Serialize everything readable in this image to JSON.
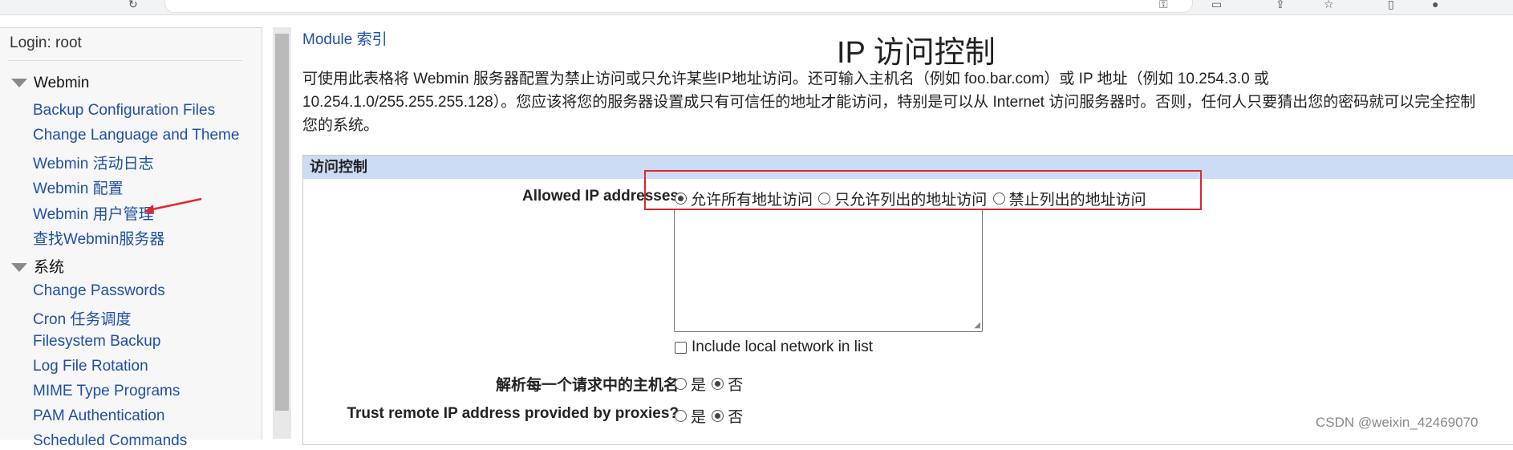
{
  "nav": {
    "login": "Login: root",
    "categories": [
      {
        "label": "Webmin",
        "items": [
          "Backup Configuration Files",
          "Change Language and Theme",
          "Webmin 活动日志",
          "Webmin 配置",
          "Webmin 用户管理",
          "查找Webmin服务器"
        ]
      },
      {
        "label": "系统",
        "items": [
          "Change Passwords",
          "Cron 任务调度",
          "Filesystem Backup",
          "Log File Rotation",
          "MIME Type Programs",
          "PAM Authentication",
          "Scheduled Commands"
        ]
      }
    ]
  },
  "main": {
    "module_index": "Module 索引",
    "title": "IP 访问控制",
    "description": [
      "可使用此表格将 Webmin 服务器配置为禁止访问或只允许某些IP地址访问。还可输入主机名（例如 foo.bar.com）或 IP 地址（例如 10.254.3.0 或",
      "10.254.1.0/255.255.255.128）。您应该将您的服务器设置成只有可信任的地址才能访问，特别是可以从 Internet 访问服务器时。否则，任何人只要猜出您的密码就可以完全控制",
      "您的系统。"
    ],
    "form": {
      "header": "访问控制",
      "allowed_label": "Allowed IP addresses",
      "allowed_options": [
        "允许所有地址访问",
        "只允许列出的地址访问",
        "禁止列出的地址访问"
      ],
      "allowed_selected": 0,
      "ip_list_value": "",
      "include_local": "Include local network in list",
      "include_local_checked": false,
      "resolve_label": "解析每一个请求中的主机名",
      "resolve_options": [
        "是",
        "否"
      ],
      "resolve_selected": 1,
      "trust_label": "Trust remote IP address provided by proxies?",
      "trust_options": [
        "是",
        "否"
      ],
      "trust_selected": 1
    }
  },
  "watermark": "CSDN @weixin_42469070",
  "colors": {
    "link": "#1f4fa5",
    "form_header_bg": "#ccdcf5",
    "annotation_red": "#e0262f"
  }
}
